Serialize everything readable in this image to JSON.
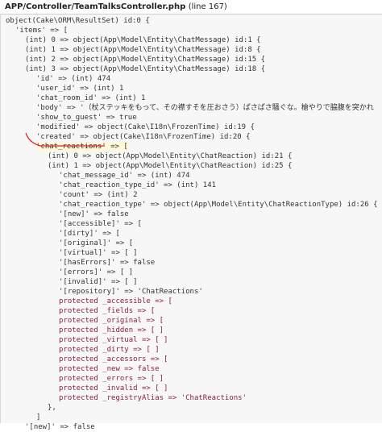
{
  "header": {
    "file": "APP/Controller/TeamTalksController.php",
    "line": "(line 167)"
  },
  "lines": [
    "object(Cake\\ORM\\ResultSet) id:0 {",
    "'items' => [",
    "(int) 0 => object(App\\Model\\Entity\\ChatMessage) id:1 {",
    "(int) 1 => object(App\\Model\\Entity\\ChatMessage) id:8 {",
    "(int) 2 => object(App\\Model\\Entity\\ChatMessage) id:15 {",
    "(int) 3 => object(App\\Model\\Entity\\ChatMessage) id:18 {",
    "'id' => (int) 474",
    "'user_id' => (int) 1",
    "'chat_room_id' => (int) 1",
    "'body' => '（杖ステッキをもって、その襟すそを圧おさう）ぱさぱさ騒ぐな。槍やりで脇腹を突かれ",
    "'show_to_guest' => true",
    "'modified' => object(Cake\\I18n\\FrozenTime) id:19 {",
    "'created' => object(Cake\\I18n\\FrozenTime) id:20 {",
    "'chat_reactions' => [",
    "(int) 0 => object(App\\Model\\Entity\\ChatReaction) id:21 {",
    "(int) 1 => object(App\\Model\\Entity\\ChatReaction) id:25 {",
    "'chat_message_id' => (int) 474",
    "'chat_reaction_type_id' => (int) 141",
    "'count' => (int) 2",
    "'chat_reaction_type' => object(App\\Model\\Entity\\ChatReactionType) id:26 {",
    "'[new]' => false",
    "'[accessible]' => [",
    "'[dirty]' => [",
    "'[original]' => [",
    "'[virtual]' => [ ]",
    "'[hasErrors]' => false",
    "'[errors]' => [ ]",
    "'[invalid]' => [ ]",
    "'[repository]' => 'ChatReactions'",
    "protected _accessible => [",
    "protected _fields => [",
    "protected _original => [",
    "protected _hidden => [ ]",
    "protected _virtual => [ ]",
    "protected _dirty => [ ]",
    "protected _accessors => [",
    "protected _new => false",
    "protected _errors => [ ]",
    "protected _invalid => [ ]",
    "protected _registryAlias => 'ChatReactions'",
    "},",
    "]",
    "'[new]' => false"
  ]
}
